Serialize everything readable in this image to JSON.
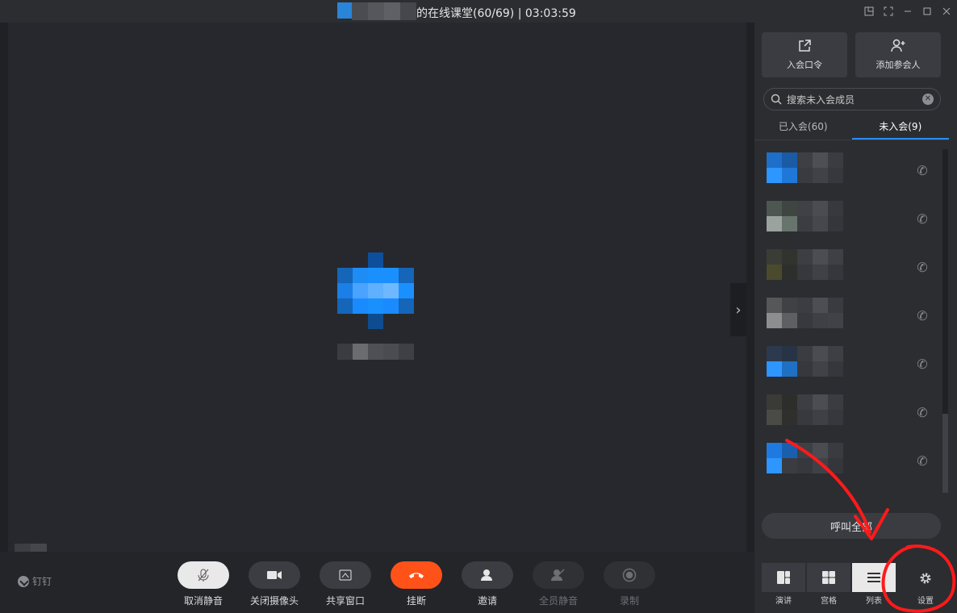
{
  "titlebar": {
    "title": "的在线课堂(60/69)  | 03:03:59",
    "controls": [
      "popout-icon",
      "fullscreen-icon",
      "minimize-icon",
      "maximize-icon",
      "close-icon"
    ]
  },
  "stage": {
    "collapse_icon": "chevron-right-icon"
  },
  "toolbar": {
    "logo_label": "钉钉",
    "buttons": {
      "unmute": "取消静音",
      "camera_off": "关闭摄像头",
      "share": "共享窗口",
      "hangup": "挂断",
      "invite": "邀请",
      "mute_all": "全员静音",
      "record": "录制"
    }
  },
  "panel": {
    "join_code": "入会口令",
    "add_participant": "添加参会人",
    "search": {
      "placeholder": "搜索未入会成员"
    },
    "tabs": [
      {
        "label": "已入会(60)",
        "active": false
      },
      {
        "label": "未入会(9)",
        "active": true
      }
    ],
    "members": [
      {
        "id": 1
      },
      {
        "id": 2
      },
      {
        "id": 3
      },
      {
        "id": 4
      },
      {
        "id": 5
      },
      {
        "id": 6
      },
      {
        "id": 7
      }
    ],
    "call_all": "呼叫全部",
    "views": [
      {
        "label": "演讲",
        "active": false
      },
      {
        "label": "宫格",
        "active": false
      },
      {
        "label": "列表",
        "active": true
      }
    ],
    "settings": "设置"
  },
  "colors": {
    "accent": "#2d8cf0",
    "hangup": "#ff5219",
    "annotation": "#ff1a1a"
  }
}
